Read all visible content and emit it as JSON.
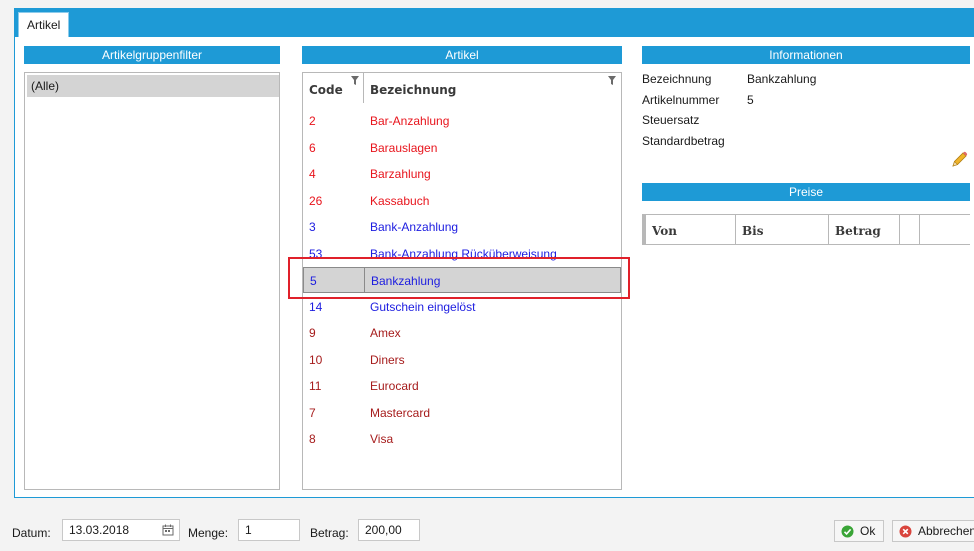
{
  "tab": {
    "label": "Artikel"
  },
  "group_filter": {
    "header": "Artikelgruppenfilter",
    "items": [
      "(Alle)"
    ]
  },
  "articles": {
    "header": "Artikel",
    "columns": {
      "code": "Code",
      "name": "Bezeichnung"
    },
    "rows": [
      {
        "code": "2",
        "name": "Bar-Anzahlung",
        "color": "#e8141c"
      },
      {
        "code": "6",
        "name": "Barauslagen",
        "color": "#e8141c"
      },
      {
        "code": "4",
        "name": "Barzahlung",
        "color": "#e8141c"
      },
      {
        "code": "26",
        "name": "Kassabuch",
        "color": "#e8141c"
      },
      {
        "code": "3",
        "name": "Bank-Anzahlung",
        "color": "#1c1ce0"
      },
      {
        "code": "53",
        "name": "Bank-Anzahlung Rücküberweisung",
        "color": "#1c1ce0"
      },
      {
        "code": "5",
        "name": "Bankzahlung",
        "color": "#1c1ce0"
      },
      {
        "code": "14",
        "name": "Gutschein eingelöst",
        "color": "#1c1ce0"
      },
      {
        "code": "9",
        "name": "Amex",
        "color": "#a61c1c"
      },
      {
        "code": "10",
        "name": "Diners",
        "color": "#a61c1c"
      },
      {
        "code": "11",
        "name": "Eurocard",
        "color": "#a61c1c"
      },
      {
        "code": "7",
        "name": "Mastercard",
        "color": "#a61c1c"
      },
      {
        "code": "8",
        "name": "Visa",
        "color": "#a61c1c"
      }
    ],
    "selected_index": 6
  },
  "information": {
    "header": "Informationen",
    "fields": [
      {
        "label": "Bezeichnung",
        "value": "Bankzahlung"
      },
      {
        "label": "Artikelnummer",
        "value": "5"
      },
      {
        "label": "Steuersatz",
        "value": ""
      },
      {
        "label": "Standardbetrag",
        "value": ""
      }
    ]
  },
  "prices": {
    "header": "Preise",
    "columns": [
      "Von",
      "Bis",
      "Betrag"
    ]
  },
  "footer": {
    "datum_label": "Datum:",
    "datum_value": "13.03.2018",
    "menge_label": "Menge:",
    "menge_value": "1",
    "betrag_label": "Betrag:",
    "betrag_value": "200,00",
    "ok_label": "Ok",
    "cancel_label": "Abbrechen"
  },
  "colors": {
    "accent": "#1e9ad6",
    "selection_outline": "#e0202a",
    "ok_icon": "#3aa537",
    "cancel_icon": "#d9453d"
  }
}
